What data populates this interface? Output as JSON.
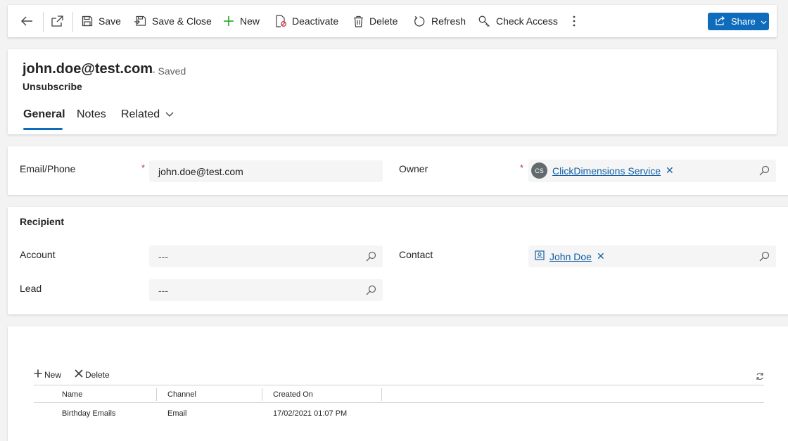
{
  "toolbar": {
    "save": "Save",
    "save_close": "Save & Close",
    "new": "New",
    "deactivate": "Deactivate",
    "delete": "Delete",
    "refresh": "Refresh",
    "check_access": "Check Access",
    "share": "Share"
  },
  "header": {
    "title": "john.doe@test.com",
    "status": "- Saved",
    "entity": "Unsubscribe",
    "tabs": [
      {
        "label": "General",
        "active": true
      },
      {
        "label": "Notes",
        "active": false
      },
      {
        "label": "Related",
        "active": false
      }
    ]
  },
  "main_section": {
    "email_label": "Email/Phone",
    "email_value": "john.doe@test.com",
    "owner_label": "Owner",
    "owner_initials": "CS",
    "owner_value": "ClickDimensions Service"
  },
  "recipient_section": {
    "title": "Recipient",
    "account_label": "Account",
    "account_value": "---",
    "lead_label": "Lead",
    "lead_value": "---",
    "contact_label": "Contact",
    "contact_value": "John Doe"
  },
  "subgrid": {
    "new_label": "New",
    "delete_label": "Delete",
    "columns": [
      "Name",
      "Channel",
      "Created On"
    ],
    "rows": [
      {
        "name": "Birthday Emails",
        "channel": "Email",
        "created_on": "17/02/2021 01:07 PM"
      }
    ]
  },
  "colors": {
    "accent": "#0f6cbd",
    "link": "#115ea3",
    "required": "#c4314b"
  }
}
